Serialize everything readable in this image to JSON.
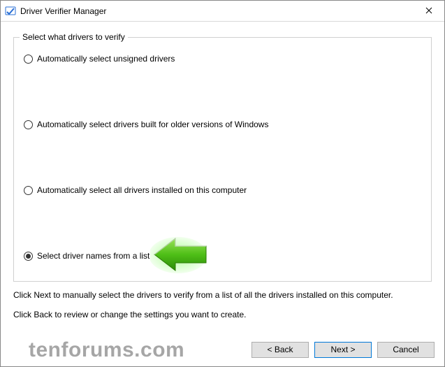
{
  "window": {
    "title": "Driver Verifier Manager",
    "icon": "verifier-app-icon",
    "close_label": "Close"
  },
  "group": {
    "legend": "Select what drivers to verify",
    "options": [
      {
        "label": "Automatically select unsigned drivers",
        "checked": false
      },
      {
        "label": "Automatically select drivers built for older versions of Windows",
        "checked": false
      },
      {
        "label": "Automatically select all drivers installed on this computer",
        "checked": false
      },
      {
        "label": "Select driver names from a list",
        "checked": true
      }
    ]
  },
  "hints": {
    "line1": "Click Next to manually select the drivers to verify from a list of all the drivers installed on this computer.",
    "line2": "Click Back to review or change the settings you want to create."
  },
  "buttons": {
    "back": "< Back",
    "next": "Next >",
    "cancel": "Cancel"
  },
  "watermark": "tenforums.com",
  "annotation": {
    "arrow": "green-arrow-pointing-left"
  }
}
